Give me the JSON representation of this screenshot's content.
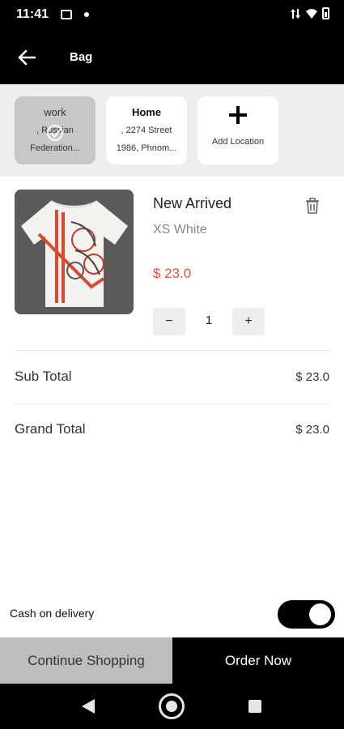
{
  "status": {
    "time": "11:41"
  },
  "appbar": {
    "title": "Bag"
  },
  "locations": [
    {
      "name": "work",
      "address": ", Russian Federation..."
    },
    {
      "name": "Home",
      "address": ", 2274 Street 1986, Phnom..."
    }
  ],
  "add_location": "Add Location",
  "cart": {
    "item": {
      "title": "New Arrived",
      "variant": "XS White",
      "price": "$ 23.0",
      "quantity": "1"
    },
    "minus": "−",
    "plus": "+"
  },
  "summary": {
    "sub_total_label": "Sub Total",
    "sub_total_value": "$ 23.0",
    "grand_total_label": "Grand Total",
    "grand_total_value": "$ 23.0"
  },
  "payment": {
    "cod_label": "Cash on delivery",
    "cod_enabled": true
  },
  "actions": {
    "continue_label": "Continue Shopping",
    "order_label": "Order Now"
  }
}
